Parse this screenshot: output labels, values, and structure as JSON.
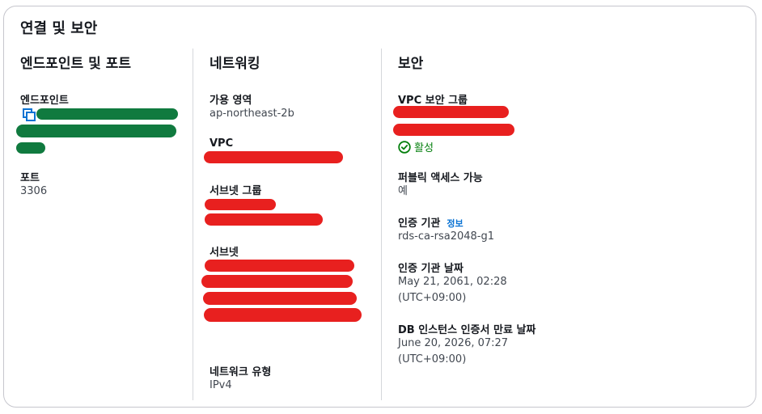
{
  "panel": {
    "title": "연결 및 보안"
  },
  "connectivity": {
    "title": "엔드포인트 및 포트",
    "endpoint_label": "엔드포인트",
    "port_label": "포트",
    "port_value": "3306"
  },
  "networking": {
    "title": "네트워킹",
    "az_label": "가용 영역",
    "az_value": "ap-northeast-2b",
    "vpc_label": "VPC",
    "subnet_group_label": "서브넷 그룹",
    "subnets_label": "서브넷",
    "network_type_label": "네트워크 유형",
    "network_type_value": "IPv4"
  },
  "security": {
    "title": "보안",
    "sg_label": "VPC 보안 그룹",
    "sg_status": "활성",
    "public_access_label": "퍼블릭 액세스 가능",
    "public_access_value": "예",
    "ca_label": "인증 기관",
    "ca_info_link": "정보",
    "ca_value": "rds-ca-rsa2048-g1",
    "ca_date_label": "인증 기관 날짜",
    "ca_date_value_1": "May 21, 2061, 02:28",
    "ca_date_value_2": "(UTC+09:00)",
    "cert_expiry_label": "DB 인스턴스 인증서 만료 날짜",
    "cert_expiry_value_1": "June 20, 2026, 07:27",
    "cert_expiry_value_2": "(UTC+09:00)"
  },
  "colors": {
    "success": "#037f0c",
    "link": "#0972d3",
    "redaction_green": "#107a3f",
    "redaction_red": "#e8201f"
  }
}
